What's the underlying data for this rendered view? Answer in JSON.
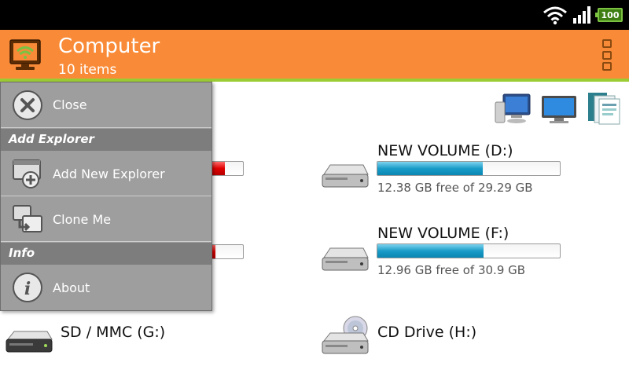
{
  "status_bar": {
    "battery": "100",
    "icons": [
      "wifi-icon",
      "signal-icon",
      "battery-icon"
    ]
  },
  "action_bar": {
    "title": "Computer",
    "subtitle": "10 items",
    "icon": "computer-wifi-icon",
    "overflow_icon": "overflow-menu-icon",
    "color": "#f98b38",
    "accent": "#9ccc33"
  },
  "view_icons": [
    "monitor-desktop-icon",
    "screen-icon",
    "documents-icon"
  ],
  "drives": [
    {
      "name": "NEW VOLUME (D:)",
      "free": "12.38 GB free of 29.29 GB",
      "used_fraction": 0.577
    },
    {
      "name": "NEW VOLUME (F:)",
      "free": "12.96 GB free of 30.9 GB",
      "used_fraction": 0.58
    },
    {
      "name": "SD / MMC (G:)"
    },
    {
      "name": "CD Drive (H:)"
    }
  ],
  "hidden_drive_bars": [
    {
      "used_fraction": 0.9,
      "color": "#e00000"
    },
    {
      "used_fraction": 0.85,
      "color": "#e00000"
    }
  ],
  "menu": {
    "close_label": "Close",
    "section_add": "Add Explorer",
    "add_new_label": "Add New Explorer",
    "clone_label": "Clone Me",
    "section_info": "Info",
    "about_label": "About"
  }
}
